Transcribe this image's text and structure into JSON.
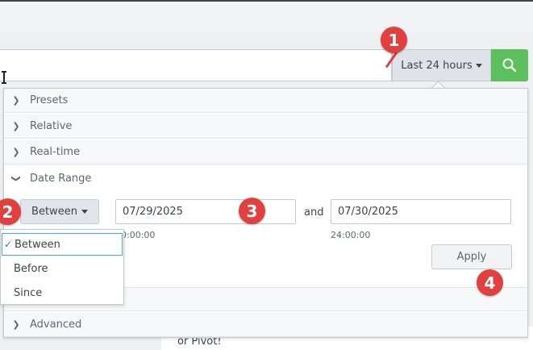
{
  "search_bar": {
    "time_picker_label": "Last 24 hours"
  },
  "background": {
    "text": "or Pivot!"
  },
  "sections": {
    "presets": "Presets",
    "relative": "Relative",
    "realtime": "Real-time",
    "date_range": "Date Range",
    "advanced": "Advanced"
  },
  "date_range": {
    "mode": "Between",
    "start_date": "07/29/2025",
    "and_label": "and",
    "end_date": "07/30/2025",
    "start_time": "00:00:00",
    "end_time": "24:00:00",
    "apply_label": "Apply"
  },
  "mode_menu": {
    "items": [
      "Between",
      "Before",
      "Since"
    ],
    "selected": "Between"
  },
  "callouts": [
    "1",
    "2",
    "3",
    "4"
  ],
  "colors": {
    "search_button": "#5cc05c",
    "callout": "#e0413e",
    "focus": "#4aa3df"
  },
  "icons": [
    "search-icon",
    "chevron-right-icon",
    "chevron-down-icon",
    "caret-down-icon",
    "checkmark-icon",
    "text-cursor-icon"
  ]
}
